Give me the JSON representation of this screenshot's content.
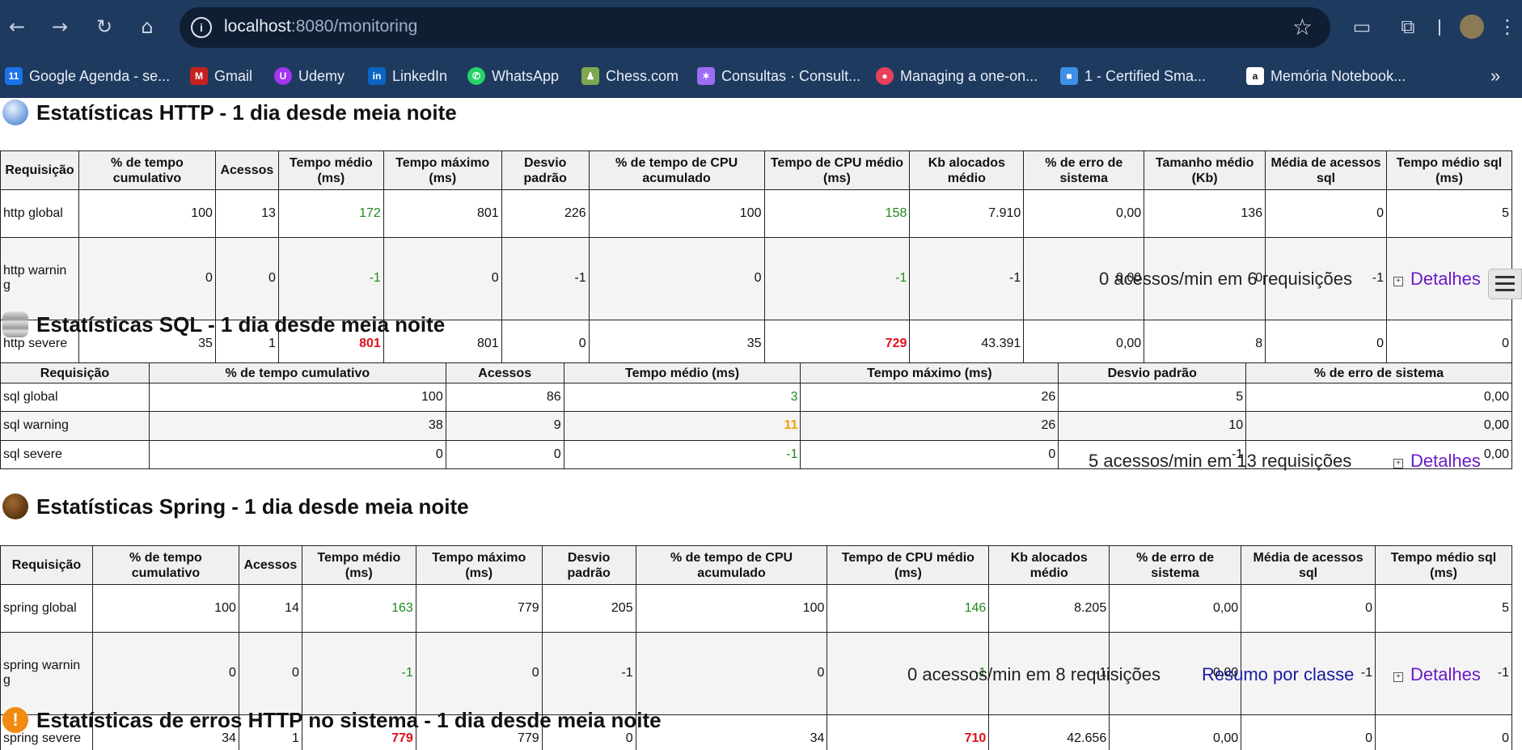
{
  "browser": {
    "url_host": "localhost",
    "url_path": ":8080/monitoring",
    "bookmarks": [
      {
        "label": "Google Agenda - se...",
        "icon": "calendar-icon",
        "color": "#1a73e8"
      },
      {
        "label": "Gmail",
        "icon": "gmail-icon",
        "color": "#c5221f"
      },
      {
        "label": "Udemy",
        "icon": "udemy-icon",
        "color": "#a435f0"
      },
      {
        "label": "LinkedIn",
        "icon": "linkedin-icon",
        "color": "#0a66c2"
      },
      {
        "label": "WhatsApp",
        "icon": "whatsapp-icon",
        "color": "#25d366"
      },
      {
        "label": "Chess.com",
        "icon": "chess-icon",
        "color": "#7fa650"
      },
      {
        "label": "Consultas · Consult...",
        "icon": "consultas-icon",
        "color": "#9c6cf2"
      },
      {
        "label": "Managing a one-on...",
        "icon": "managing-icon",
        "color": "#e8405a"
      },
      {
        "label": "1 - Certified Sma...",
        "icon": "cube-icon",
        "color": "#3d8fe8"
      },
      {
        "label": "Memória Notebook...",
        "icon": "amazon-icon",
        "color": "#ffffff"
      }
    ]
  },
  "http": {
    "title": "Estatísticas HTTP - 1 dia desde meia noite",
    "headers": [
      "Requisição",
      "% de tempo cumulativo",
      "Acessos",
      "Tempo médio (ms)",
      "Tempo máximo (ms)",
      "Desvio padrão",
      "% de tempo de CPU acumulado",
      "Tempo de CPU médio (ms)",
      "Kb alocados médio",
      "% de erro de sistema",
      "Tamanho médio (Kb)",
      "Média de acessos sql",
      "Tempo médio sql (ms)"
    ],
    "rows": [
      [
        "http global",
        "100",
        "13",
        "172",
        "801",
        "226",
        "100",
        "158",
        "7.910",
        "0,00",
        "136",
        "0",
        "5"
      ],
      [
        "http warnin g",
        "0",
        "0",
        "-1",
        "0",
        "-1",
        "0",
        "-1",
        "-1",
        "0,00",
        "0",
        "-1",
        "-1"
      ],
      [
        "http severe",
        "35",
        "1",
        "801",
        "801",
        "0",
        "35",
        "729",
        "43.391",
        "0,00",
        "8",
        "0",
        "0"
      ]
    ],
    "summary": "0 acessos/min em 6 requisições",
    "details": "Detalhes"
  },
  "sql": {
    "title": "Estatísticas SQL - 1 dia desde meia noite",
    "headers": [
      "Requisição",
      "% de tempo cumulativo",
      "Acessos",
      "Tempo médio (ms)",
      "Tempo máximo (ms)",
      "Desvio padrão",
      "% de erro de sistema"
    ],
    "rows": [
      [
        "sql global",
        "100",
        "86",
        "3",
        "26",
        "5",
        "0,00"
      ],
      [
        "sql warning",
        "38",
        "9",
        "11",
        "26",
        "10",
        "0,00"
      ],
      [
        "sql severe",
        "0",
        "0",
        "-1",
        "0",
        "-1",
        "0,00"
      ]
    ],
    "summary": "5 acessos/min em 13 requisições",
    "details": "Detalhes"
  },
  "spring": {
    "title": "Estatísticas Spring - 1 dia desde meia noite",
    "headers": [
      "Requisição",
      "% de tempo cumulativo",
      "Acessos",
      "Tempo médio (ms)",
      "Tempo máximo (ms)",
      "Desvio padrão",
      "% de tempo de CPU acumulado",
      "Tempo de CPU médio (ms)",
      "Kb alocados médio",
      "% de erro de sistema",
      "Média de acessos sql",
      "Tempo médio sql (ms)"
    ],
    "rows": [
      [
        "spring global",
        "100",
        "14",
        "163",
        "779",
        "205",
        "100",
        "146",
        "8.205",
        "0,00",
        "0",
        "5"
      ],
      [
        "spring warnin g",
        "0",
        "0",
        "-1",
        "0",
        "-1",
        "0",
        "-1",
        "-1",
        "0,00",
        "-1",
        "-1"
      ],
      [
        "spring severe",
        "34",
        "1",
        "779",
        "779",
        "0",
        "34",
        "710",
        "42.656",
        "0,00",
        "0",
        "0"
      ]
    ],
    "summary": "0 acessos/min em 8 requisições",
    "class_summary": "Resumo por classe",
    "details": "Detalhes"
  },
  "errors": {
    "title": "Estatísticas de erros HTTP no sistema - 1 dia desde meia noite"
  }
}
